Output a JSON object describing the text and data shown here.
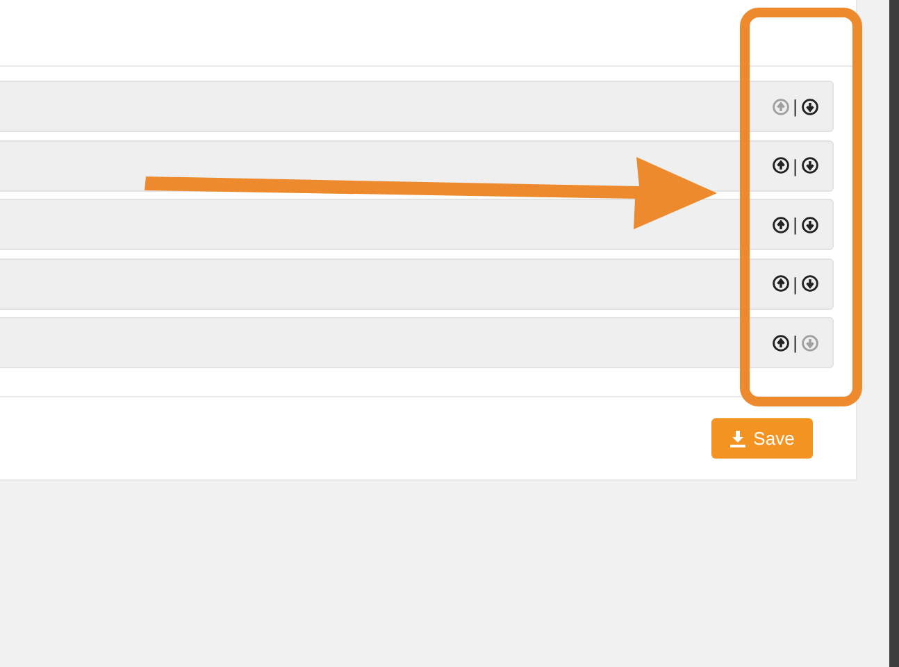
{
  "rows": [
    {
      "up_disabled": true,
      "separator": "|",
      "down_disabled": false
    },
    {
      "up_disabled": false,
      "separator": "|",
      "down_disabled": false
    },
    {
      "up_disabled": false,
      "separator": "|",
      "down_disabled": false
    },
    {
      "up_disabled": false,
      "separator": "|",
      "down_disabled": false
    },
    {
      "up_disabled": false,
      "separator": "|",
      "down_disabled": true
    }
  ],
  "save_button": {
    "label": "Save"
  }
}
